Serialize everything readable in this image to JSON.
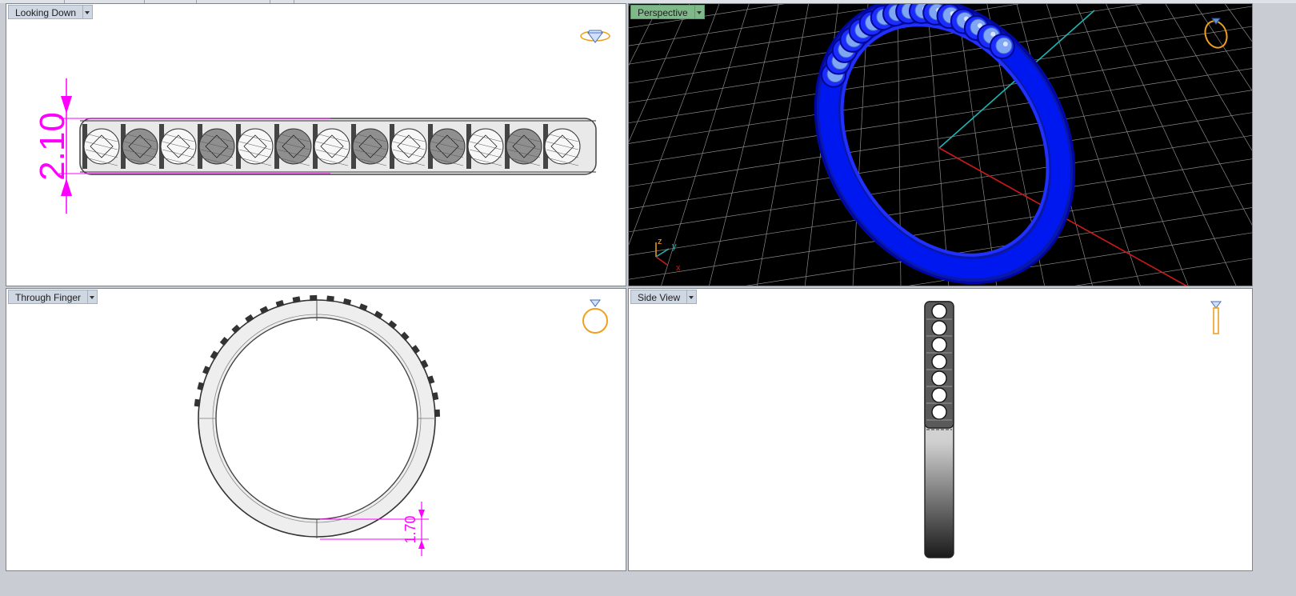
{
  "colors": {
    "dimension": "#ff00ff",
    "ring_blue": "#0010e6",
    "grid": "#8a8a8a",
    "axis_cyan": "#1fb5b5",
    "axis_red": "#cc1a1a",
    "icon_orange": "#f0a020",
    "active_label": "#7fb98a"
  },
  "viewports": {
    "top_left": {
      "label": "Looking Down",
      "dimension": "2.10",
      "icon": "diamond-icon"
    },
    "top_right": {
      "label": "Perspective",
      "icon": "ring-icon",
      "axes": {
        "z": "z",
        "y": "y",
        "x": "x"
      }
    },
    "bottom_left": {
      "label": "Through Finger",
      "dimension": "1.70",
      "icon": "ring-front-icon"
    },
    "bottom_right": {
      "label": "Side View",
      "icon": "ring-side-icon"
    }
  }
}
